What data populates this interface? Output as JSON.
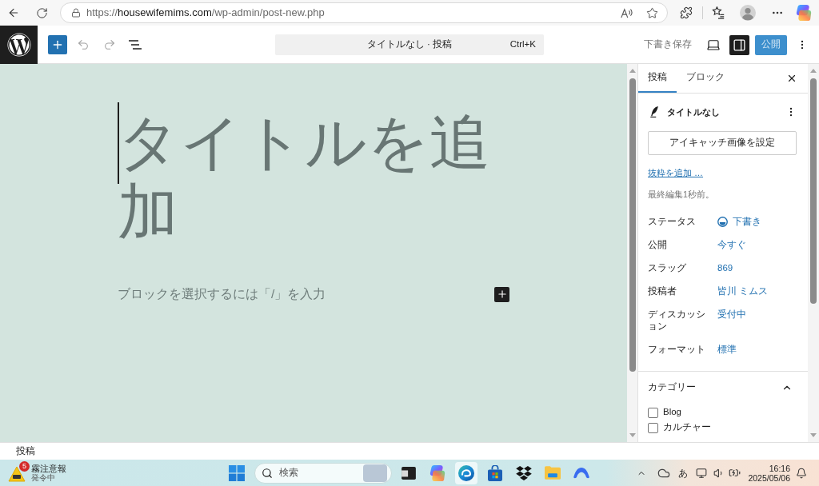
{
  "browser": {
    "url": {
      "scheme": "https://",
      "host": "housewifemims.com",
      "path": "/wp-admin/post-new.php"
    }
  },
  "editor_header": {
    "command_center": {
      "title": "タイトルなし · 投稿",
      "shortcut": "Ctrl+K"
    },
    "save_draft": "下書き保存",
    "sidebar_toggle": {
      "pressed": true
    },
    "publish": "公開"
  },
  "canvas": {
    "title_placeholder": "タイトルを追加",
    "block_placeholder": "ブロックを選択するには「/」を入力"
  },
  "sidebar": {
    "tabs": [
      {
        "label": "投稿",
        "selected": true
      },
      {
        "label": "ブロック",
        "selected": false
      }
    ],
    "post": {
      "title": "タイトルなし",
      "featured_image_button": "アイキャッチ画像を設定",
      "excerpt_link": "抜粋を追加 …",
      "last_edited": "最終編集1秒前。"
    },
    "fields": [
      {
        "label": "ステータス",
        "value": "下書き",
        "kind": "status"
      },
      {
        "label": "公開",
        "value": "今すぐ",
        "kind": "link"
      },
      {
        "label": "スラッグ",
        "value": "869",
        "kind": "link"
      },
      {
        "label": "投稿者",
        "value": "皆川 ミムス",
        "kind": "link"
      },
      {
        "label": "ディスカッション",
        "value": "受付中",
        "kind": "link"
      },
      {
        "label": "フォーマット",
        "value": "標準",
        "kind": "link"
      }
    ],
    "categories": {
      "title": "カテゴリー",
      "expanded": true,
      "items": [
        {
          "label": "Blog",
          "checked": false
        },
        {
          "label": "カルチャー",
          "checked": false
        }
      ]
    }
  },
  "status_bar": {
    "breadcrumb": "投稿"
  },
  "taskbar": {
    "weather": {
      "badge": "5",
      "title": "霧注意報",
      "subtitle": "発令中"
    },
    "search": {
      "placeholder": "検索"
    },
    "apps": [
      {
        "kind": "square",
        "selected": false
      },
      {
        "kind": "knot",
        "selected": false
      },
      {
        "kind": "swirl",
        "selected": true
      },
      {
        "kind": "bag",
        "selected": false
      },
      {
        "kind": "diamonds",
        "selected": false
      },
      {
        "kind": "folder",
        "selected": false
      },
      {
        "kind": "arc",
        "selected": false
      }
    ],
    "tray": {
      "ime": "あ"
    },
    "clock": {
      "time": "16:16",
      "date": "2025/05/06"
    }
  }
}
